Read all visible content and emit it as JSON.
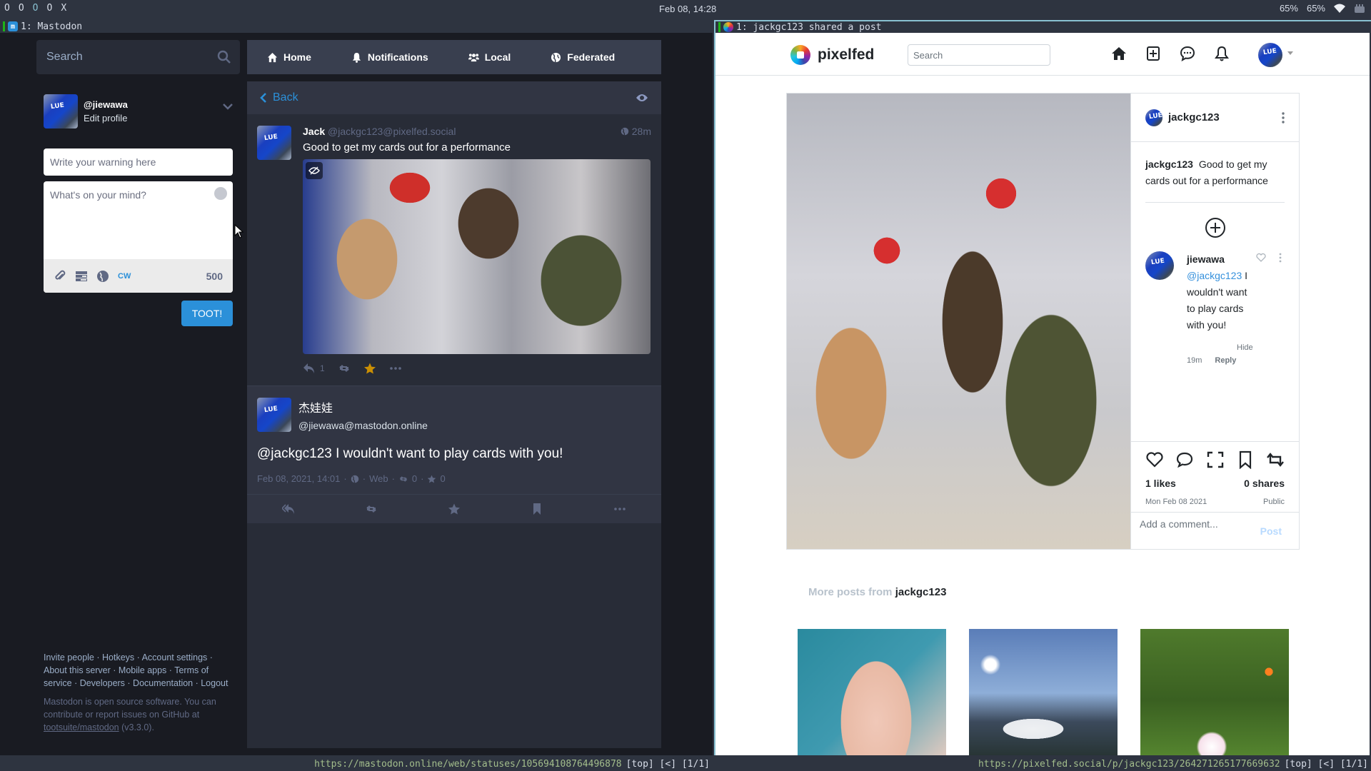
{
  "system_bar": {
    "workspaces": [
      "O",
      "O",
      "O",
      "O",
      "X"
    ],
    "active_workspace_index": 2,
    "clock": "Feb 08, 14:28",
    "tray": {
      "brightness": "65%",
      "volume": "65%",
      "wifi_icon": "wifi-icon",
      "keyboard_icon": "keyboard-icon"
    }
  },
  "mastodon_window": {
    "title": "1: Mastodon",
    "status_url": "https://mastodon.online/web/statuses/105694108764496878",
    "status_extra": "[top] [<] [1/1]",
    "search_placeholder": "Search",
    "profile": {
      "acct": "@jiewawa",
      "edit_label": "Edit profile"
    },
    "compose": {
      "warning_placeholder": "Write your warning here",
      "text_placeholder": "What's on your mind?",
      "cw_label": "CW",
      "char_count": "500",
      "toot_label": "TOOT!"
    },
    "nav": {
      "tabs": [
        {
          "label": "Home",
          "icon": "home-icon"
        },
        {
          "label": "Notifications",
          "icon": "bell-icon"
        },
        {
          "label": "Local",
          "icon": "users-icon"
        },
        {
          "label": "Federated",
          "icon": "globe-icon"
        }
      ]
    },
    "back_label": "Back",
    "ancestor_status": {
      "display_name": "Jack",
      "username": "@jackgc123@pixelfed.social",
      "time": "28m",
      "text": "Good to get my cards out for a performance",
      "reply_count": "1",
      "favourited": true
    },
    "focused_status": {
      "display_name": "杰娃娃",
      "username": "@jiewawa@mastodon.online",
      "text": "@jackgc123 I wouldn't want to play cards with you!",
      "date": "Feb 08, 2021, 14:01",
      "application": "Web",
      "reblogs": "0",
      "favourites": "0"
    },
    "footer": {
      "links": [
        "Invite people",
        "Hotkeys",
        "Account settings",
        "About this server",
        "Mobile apps",
        "Terms of service",
        "Developers",
        "Documentation",
        "Logout"
      ],
      "about_prefix": "Mastodon is open source software. You can contribute or report issues on GitHub at ",
      "repo_link": "tootsuite/mastodon",
      "version": " (v3.3.0)."
    },
    "colors": {
      "accent": "#2b90d9",
      "favourite": "#ca8f04",
      "bg": "#191b22"
    }
  },
  "pixelfed_window": {
    "title": "1: jackgc123 shared a post",
    "status_url": "https://pixelfed.social/p/jackgc123/264271265177669632",
    "status_extra": "[top] [<] [1/1]",
    "brand": "pixelfed",
    "search_placeholder": "Search",
    "post": {
      "author": "jackgc123",
      "caption": "Good to get my cards out for a performance",
      "likes": "1 likes",
      "shares": "0 shares",
      "date": "Mon Feb 08 2021",
      "visibility": "Public",
      "comment_placeholder": "Add a comment...",
      "post_label": "Post"
    },
    "comment": {
      "author": "jiewawa",
      "mention": "@jackgc123",
      "text": " I wouldn't want to play cards with you!",
      "hide_label": "Hide",
      "time": "19m",
      "reply_label": "Reply"
    },
    "more_posts": {
      "label": "More posts from",
      "user": "jackgc123"
    }
  }
}
